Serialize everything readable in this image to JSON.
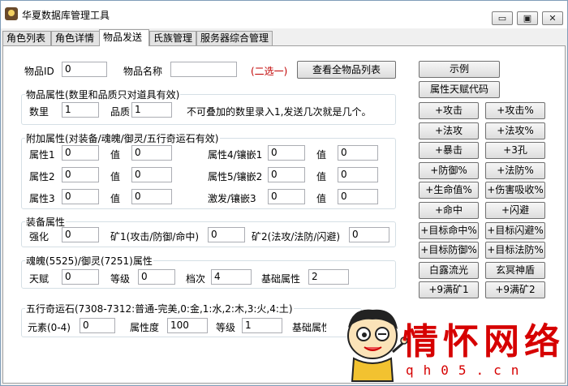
{
  "window": {
    "title": "华夏数据库管理工具",
    "min_label": "▭",
    "restore_label": "▣",
    "close_label": "✕"
  },
  "tabs": [
    "角色列表",
    "角色详情",
    "物品发送",
    "氏族管理",
    "服务器综合管理"
  ],
  "item": {
    "id_label": "物品ID",
    "id_value": "0",
    "name_label": "物品名称",
    "name_value": "",
    "choose_hint": "(二选一)",
    "view_all_button": "查看全物品列表"
  },
  "attr_group": {
    "title": "物品属性(数里和品质只对道具有效)",
    "qty_label": "数里",
    "qty_value": "1",
    "quality_label": "品质",
    "quality_value": "1",
    "note": "不可叠加的数里录入1,发送几次就是几个。"
  },
  "extra_group": {
    "title": "附加属性(对装备/魂魄/御灵/五行奇运石有效)",
    "value_label": "值",
    "rows": [
      {
        "l1": "属性1",
        "v1": "0",
        "x1": "0",
        "l2": "属性4/镶嵌1",
        "v2": "0",
        "x2": "0"
      },
      {
        "l1": "属性2",
        "v1": "0",
        "x1": "0",
        "l2": "属性5/镶嵌2",
        "v2": "0",
        "x2": "0"
      },
      {
        "l1": "属性3",
        "v1": "0",
        "x1": "0",
        "l2": "激发/镶嵌3",
        "v2": "0",
        "x2": "0"
      }
    ]
  },
  "equip_group": {
    "title": "装备属性",
    "enhance_label": "强化",
    "enhance_value": "0",
    "mine1_label": "矿1(攻击/防御/命中)",
    "mine1_value": "0",
    "mine2_label": "矿2(法攻/法防/闪避)",
    "mine2_value": "0"
  },
  "soul_group": {
    "title": "魂魄(5525)/御灵(7251)属性",
    "talent_label": "天赋",
    "talent_value": "0",
    "level_label": "等级",
    "level_value": "0",
    "grade_label": "档次",
    "grade_value": "4",
    "base_label": "基础属性",
    "base_value": "2"
  },
  "stone_group": {
    "title": "五行奇运石(7308-7312:普通-完美,0:金,1:水,2:木,3:火,4:土)",
    "element_label": "元素(0-4)",
    "element_value": "0",
    "attr_label": "属性度",
    "attr_value": "100",
    "level_label": "等级",
    "level_value": "1",
    "base_label": "基础属性"
  },
  "side_buttons": {
    "example": "示例",
    "talent_code": "属性天赋代码",
    "pairs": [
      [
        "+攻击",
        "+攻击%"
      ],
      [
        "+法攻",
        "+法攻%"
      ],
      [
        "+暴击",
        "+3孔"
      ],
      [
        "+防御%",
        "+法防%"
      ],
      [
        "+生命值%",
        "+伤害吸收%"
      ],
      [
        "+命中",
        "+闪避"
      ],
      [
        "+目标命中%",
        "+目标闪避%"
      ],
      [
        "+目标防御%",
        "+目标法防%"
      ],
      [
        "白露流光",
        "玄冥神盾"
      ],
      [
        "+9满矿1",
        "+9满矿2"
      ]
    ]
  },
  "watermark": {
    "text": "情怀网络",
    "url": "qh05.cn"
  },
  "colors": {
    "hint_red": "#c00000",
    "watermark_red": "#d60000"
  }
}
